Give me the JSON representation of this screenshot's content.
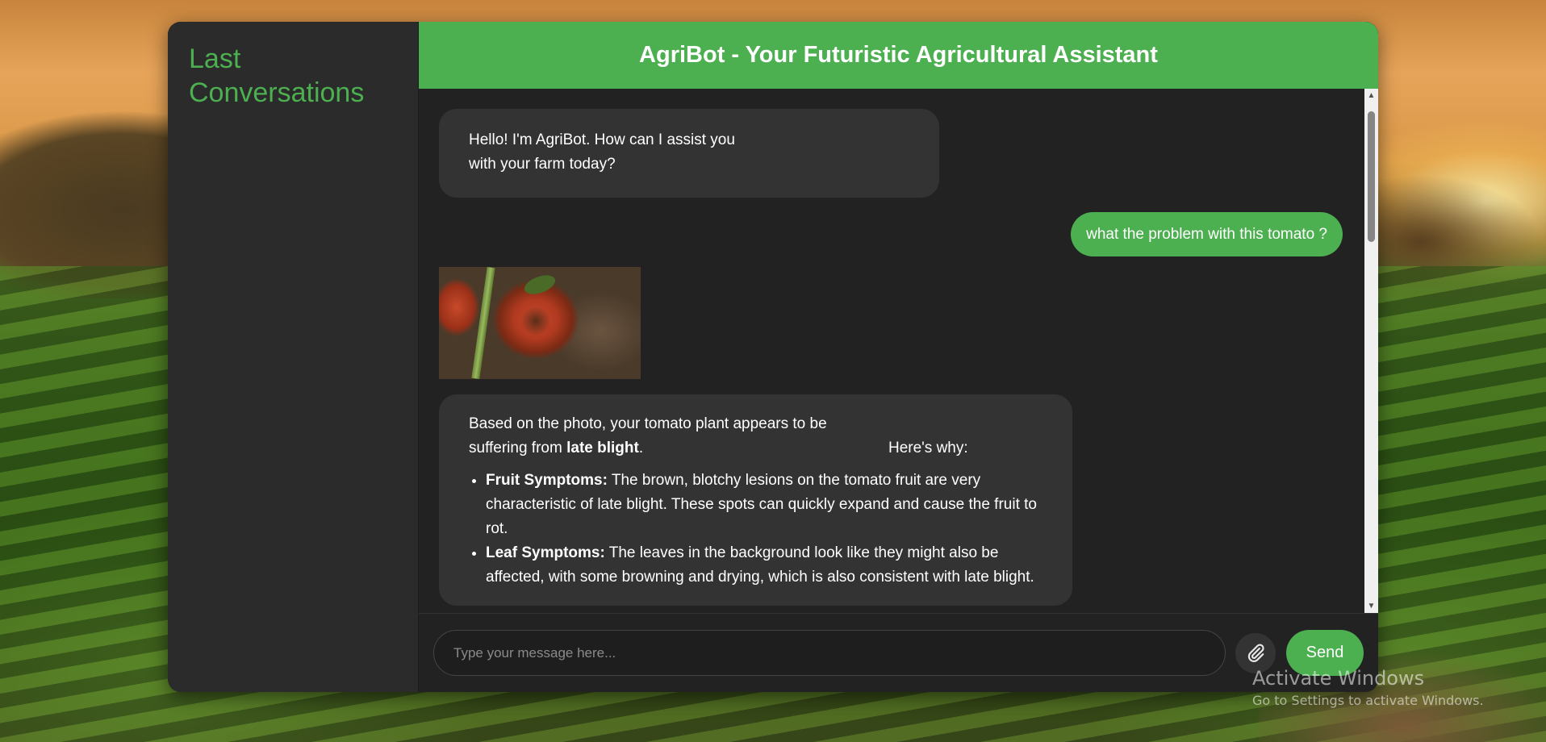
{
  "sidebar": {
    "title": "Last Conversations"
  },
  "header": {
    "title": "AgriBot - Your Futuristic Agricultural Assistant"
  },
  "messages": {
    "bot_greeting": "Hello! I'm AgriBot. How can I assist you with your farm today?",
    "user_question": "what the problem with this tomato ?",
    "bot_answer": {
      "intro_prefix": "Based on the photo, your tomato plant appears to be suffering from ",
      "intro_bold": "late blight",
      "intro_suffix": ".",
      "heres_why": "Here's why:",
      "bullets": [
        {
          "title": "Fruit Symptoms:",
          "text": " The brown, blotchy lesions on the tomato fruit are very characteristic of late blight. These spots can quickly expand and cause the fruit to rot."
        },
        {
          "title": "Leaf Symptoms:",
          "text": " The leaves in the background look like they might also be affected, with some browning and drying, which is also consistent with late blight."
        }
      ]
    }
  },
  "composer": {
    "placeholder": "Type your message here...",
    "send_label": "Send",
    "attach_icon": "paperclip-icon"
  },
  "system_overlay": {
    "line1": "Activate Windows",
    "line2": "Go to Settings to activate Windows."
  },
  "colors": {
    "accent": "#4caf50",
    "sidebar_bg": "#2b2b2b",
    "chat_bg": "#222222",
    "bot_bubble": "#333333"
  }
}
